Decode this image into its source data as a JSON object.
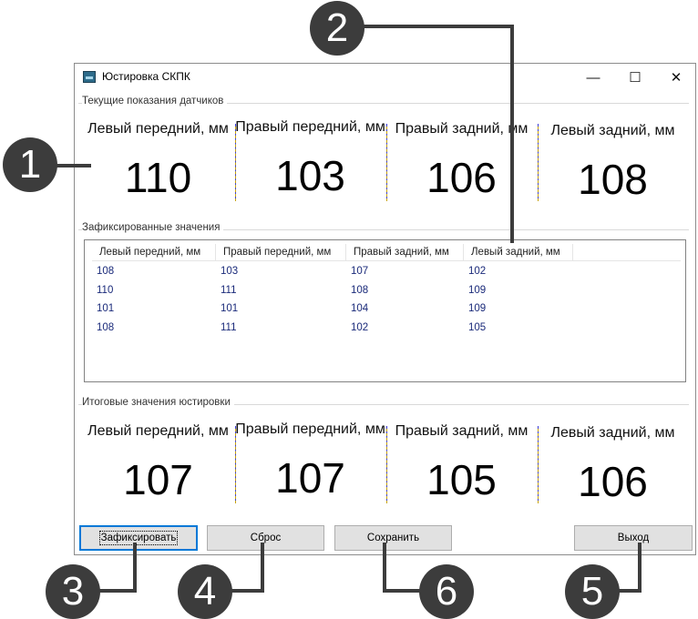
{
  "window": {
    "title": "Юстировка СКПК",
    "controls": {
      "minimize": "—",
      "maximize": "☐",
      "close": "✕"
    }
  },
  "current": {
    "label": "Текущие показания датчиков",
    "columns": [
      {
        "header": "Левый передний, мм",
        "value": "110"
      },
      {
        "header": "Правый передний, мм",
        "value": "103"
      },
      {
        "header": "Правый задний, мм",
        "value": "106"
      },
      {
        "header": "Левый задний, мм",
        "value": "108"
      }
    ]
  },
  "fixed": {
    "label": "Зафиксированные значения",
    "headers": [
      "Левый передний, мм",
      "Правый передний, мм",
      "Правый задний, мм",
      "Левый задний, мм"
    ],
    "rows": [
      [
        "108",
        "103",
        "107",
        "102"
      ],
      [
        "110",
        "111",
        "108",
        "109"
      ],
      [
        "101",
        "101",
        "104",
        "109"
      ],
      [
        "108",
        "111",
        "102",
        "105"
      ]
    ]
  },
  "results": {
    "label": "Итоговые значения юстировки",
    "columns": [
      {
        "header": "Левый передний, мм",
        "value": "107"
      },
      {
        "header": "Правый передний, мм",
        "value": "107"
      },
      {
        "header": "Правый задний, мм",
        "value": "105"
      },
      {
        "header": "Левый задний, мм",
        "value": "106"
      }
    ]
  },
  "buttons": {
    "fix": "Зафиксировать",
    "reset": "Сброс",
    "save": "Сохранить",
    "exit": "Выход"
  },
  "callouts": [
    "1",
    "2",
    "3",
    "4",
    "5",
    "6"
  ],
  "colors": {
    "callout": "#3c3c3c",
    "focus": "#0078d7",
    "list_text": "#1a2a7a"
  }
}
